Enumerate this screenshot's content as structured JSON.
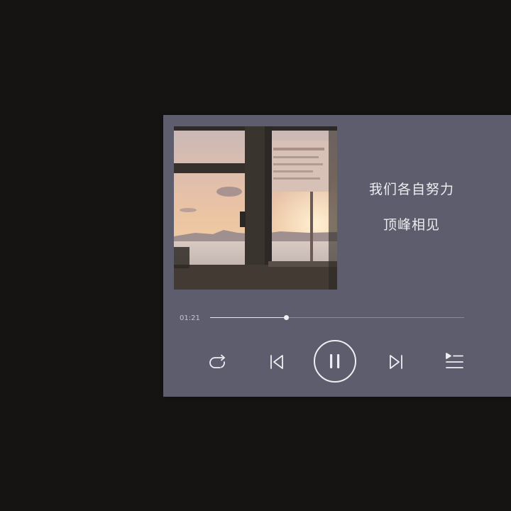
{
  "player": {
    "lyrics": [
      "我们各自努力",
      "顶峰相见"
    ],
    "elapsed": "01:21",
    "progress": 0.3,
    "state": "playing",
    "controls": {
      "repeat": "repeat-icon",
      "previous": "previous-track-icon",
      "play_pause": "pause-icon",
      "next": "next-track-icon",
      "playlist": "playlist-icon"
    },
    "colors": {
      "panel": "#5d5d6d",
      "background": "#161412",
      "foreground": "#eeeef2"
    }
  }
}
